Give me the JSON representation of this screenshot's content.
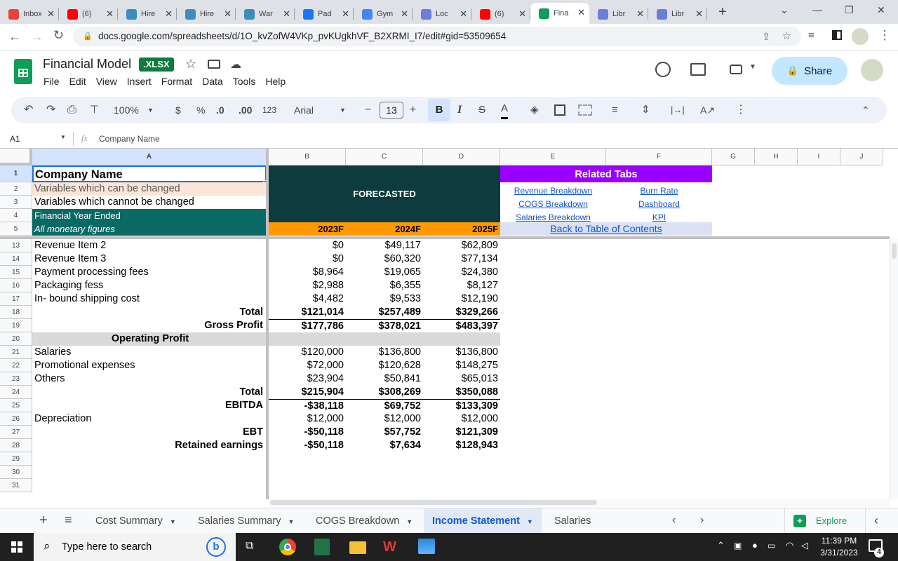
{
  "browser": {
    "tabs": [
      {
        "title": "Inbox",
        "icon": "gmail-icon",
        "color": "#ea4335"
      },
      {
        "title": "(6)",
        "icon": "youtube-icon",
        "color": "#ff0000"
      },
      {
        "title": "Hire",
        "icon": "hire-icon",
        "color": "#3c8dbc"
      },
      {
        "title": "Hire",
        "icon": "hire-icon",
        "color": "#3c8dbc"
      },
      {
        "title": "War",
        "icon": "war-icon",
        "color": "#3c8dbc"
      },
      {
        "title": "Pad",
        "icon": "facebook-icon",
        "color": "#1877f2"
      },
      {
        "title": "Gym",
        "icon": "docs-icon",
        "color": "#4285f4"
      },
      {
        "title": "Loc",
        "icon": "gear-icon",
        "color": "#6b7fd7"
      },
      {
        "title": "(6)",
        "icon": "youtube-icon",
        "color": "#ff0000"
      },
      {
        "title": "Fina",
        "icon": "sheets-icon",
        "color": "#0f9d58",
        "active": true
      },
      {
        "title": "Libr",
        "icon": "gear-icon",
        "color": "#6b7fd7"
      },
      {
        "title": "Libr",
        "icon": "gear-icon",
        "color": "#6b7fd7"
      }
    ],
    "url": "docs.google.com/spreadsheets/d/1O_kvZofW4VKp_pvKUgkhVF_B2XRMI_I7/edit#gid=53509654"
  },
  "doc": {
    "title": "Financial Model",
    "badge": ".XLSX",
    "menu": [
      "File",
      "Edit",
      "View",
      "Insert",
      "Format",
      "Data",
      "Tools",
      "Help"
    ],
    "share_label": "Share"
  },
  "toolbar": {
    "zoom": "100%",
    "currency": "$",
    "percent": "%",
    "dec_minus": ".0",
    "dec_plus": ".00",
    "number_format": "123",
    "font": "Arial",
    "font_size": "13"
  },
  "formula_bar": {
    "cell_ref": "A1",
    "fx": "fx",
    "content": "Company Name"
  },
  "columns": [
    "A",
    "B",
    "C",
    "D",
    "E",
    "F",
    "G",
    "H",
    "I",
    "J"
  ],
  "header_rows": {
    "row1": "Company Name",
    "row2": "Variables which can be changed",
    "row3": "Variables which cannot be changed",
    "row4": "Financial Year Ended",
    "row5": "All monetary figures",
    "forecasted": "FORECASTED",
    "years": [
      "2023F",
      "2024F",
      "2025F"
    ],
    "related_tabs_title": "Related Tabs",
    "related_links": [
      "Revenue Breakdown",
      "Burn Rate",
      "COGS Breakdown",
      "Dashboard",
      "Salaries Breakdown",
      "KPI"
    ],
    "back_link": "Back to Table of Contents"
  },
  "rows": [
    {
      "num": "13",
      "label": "Revenue Item 2",
      "align": "left",
      "bold": false,
      "values": [
        "$0",
        "$49,117",
        "$62,809"
      ]
    },
    {
      "num": "14",
      "label": "Revenue Item 3",
      "align": "left",
      "bold": false,
      "values": [
        "$0",
        "$60,320",
        "$77,134"
      ]
    },
    {
      "num": "15",
      "label": "Payment processing fees",
      "align": "left",
      "bold": false,
      "values": [
        "$8,964",
        "$19,065",
        "$24,380"
      ]
    },
    {
      "num": "16",
      "label": "Packaging fess",
      "align": "left",
      "bold": false,
      "values": [
        "$2,988",
        "$6,355",
        "$8,127"
      ]
    },
    {
      "num": "17",
      "label": "In- bound shipping cost",
      "align": "left",
      "bold": false,
      "values": [
        "$4,482",
        "$9,533",
        "$12,190"
      ]
    },
    {
      "num": "18",
      "label": "Total",
      "align": "right",
      "bold": true,
      "values": [
        "$121,014",
        "$257,489",
        "$329,266"
      ]
    },
    {
      "num": "19",
      "label": "Gross Profit",
      "align": "right",
      "bold": true,
      "values": [
        "$177,786",
        "$378,021",
        "$483,397"
      ]
    },
    {
      "num": "20",
      "label": "Operating Profit",
      "align": "center",
      "bold": true,
      "values": [
        "",
        "",
        ""
      ]
    },
    {
      "num": "21",
      "label": "Salaries",
      "align": "left",
      "bold": false,
      "values": [
        "$120,000",
        "$136,800",
        "$136,800"
      ]
    },
    {
      "num": "22",
      "label": "Promotional expenses",
      "align": "left",
      "bold": false,
      "values": [
        "$72,000",
        "$120,628",
        "$148,275"
      ]
    },
    {
      "num": "23",
      "label": "Others",
      "align": "left",
      "bold": false,
      "values": [
        "$23,904",
        "$50,841",
        "$65,013"
      ]
    },
    {
      "num": "24",
      "label": "Total",
      "align": "right",
      "bold": true,
      "values": [
        "$215,904",
        "$308,269",
        "$350,088"
      ]
    },
    {
      "num": "25",
      "label": "EBITDA",
      "align": "right",
      "bold": true,
      "values": [
        "-$38,118",
        "$69,752",
        "$133,309"
      ]
    },
    {
      "num": "26",
      "label": "Depreciation",
      "align": "left",
      "bold": false,
      "values": [
        "$12,000",
        "$12,000",
        "$12,000"
      ]
    },
    {
      "num": "27",
      "label": "EBT",
      "align": "right",
      "bold": true,
      "values": [
        "-$50,118",
        "$57,752",
        "$121,309"
      ]
    },
    {
      "num": "28",
      "label": "Retained earnings",
      "align": "right",
      "bold": true,
      "values": [
        "-$50,118",
        "$7,634",
        "$128,943"
      ]
    },
    {
      "num": "29",
      "label": "",
      "align": "left",
      "bold": false,
      "values": [
        "",
        "",
        ""
      ]
    },
    {
      "num": "30",
      "label": "",
      "align": "left",
      "bold": false,
      "values": [
        "",
        "",
        ""
      ]
    },
    {
      "num": "31",
      "label": "",
      "align": "left",
      "bold": false,
      "values": [
        "",
        "",
        ""
      ]
    }
  ],
  "sheet_tabs": [
    "Cost Summary",
    "Salaries Summary",
    "COGS Breakdown",
    "Income Statement",
    "Salaries Breakdown"
  ],
  "active_sheet": "Income Statement",
  "explore_label": "Explore",
  "taskbar": {
    "search_placeholder": "Type here to search",
    "time": "11:39 PM",
    "date": "3/31/2023",
    "notifications": "4"
  },
  "colors": {
    "dark_teal": "#0d3b3e",
    "teal": "#0b6963",
    "orange": "#ff9900",
    "purple": "#9900ff",
    "peach": "#fce5d7",
    "link_blue": "#1155cc",
    "active_tab_blue": "#0b57d0"
  }
}
